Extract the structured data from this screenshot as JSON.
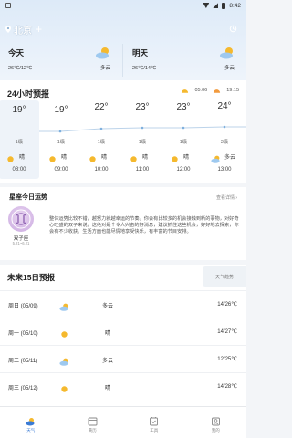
{
  "status_bar": {
    "time": "8:42"
  },
  "header": {
    "city": "北京",
    "add_symbol": "+"
  },
  "today": {
    "label": "今天",
    "temp": "26℃/12℃",
    "condition": "多云"
  },
  "tomorrow": {
    "label": "明天",
    "temp": "26℃/14℃",
    "condition": "多云"
  },
  "hourly": {
    "title": "24小时预报",
    "sunrise": "05:06",
    "sunset": "19:15",
    "items": [
      {
        "temp": "19°",
        "wind": "1级",
        "condition": "晴",
        "time": "08:00",
        "icon": "sun-icon"
      },
      {
        "temp": "19°",
        "wind": "1级",
        "condition": "晴",
        "time": "09:00",
        "icon": "sun-icon"
      },
      {
        "temp": "22°",
        "wind": "1级",
        "condition": "晴",
        "time": "10:00",
        "icon": "sun-icon"
      },
      {
        "temp": "23°",
        "wind": "1级",
        "condition": "晴",
        "time": "11:00",
        "icon": "sun-icon"
      },
      {
        "temp": "23°",
        "wind": "1级",
        "condition": "晴",
        "time": "12:00",
        "icon": "sun-icon"
      },
      {
        "temp": "24°",
        "wind": "3级",
        "condition": "多云",
        "time": "13:00",
        "icon": "partly-cloudy-icon"
      }
    ]
  },
  "horoscope": {
    "title": "星座今日运势",
    "more": "查看详情 ›",
    "sign": "双子座",
    "dates": "5.21~6.21",
    "text": "整体运势比较不错，越努力就越幸运的节奏。你会有比较多的机会接触到新的事物，对好奇心旺盛的双子来说，这绝对是个令人兴奋的好消息，建议抓住这些机会，好好地去探索，你会有不少收获。生活方面也能尽情地享受快乐，有丰富的节目安排。"
  },
  "forecast": {
    "title": "未来15日预报",
    "trend_button": "天气趋势",
    "days": [
      {
        "day": "周日 (05/09)",
        "condition": "多云",
        "temp": "14/26℃",
        "icon": "partly-cloudy-icon"
      },
      {
        "day": "周一 (05/10)",
        "condition": "晴",
        "temp": "14/27℃",
        "icon": "sun-icon"
      },
      {
        "day": "周二 (05/11)",
        "condition": "多云",
        "temp": "12/25℃",
        "icon": "partly-cloudy-icon"
      },
      {
        "day": "周三 (05/12)",
        "condition": "晴",
        "temp": "14/28℃",
        "icon": "sun-icon"
      }
    ]
  },
  "nav": {
    "items": [
      {
        "label": "天气",
        "icon": "weather-icon"
      },
      {
        "label": "黄历",
        "icon": "almanac-icon"
      },
      {
        "label": "工具",
        "icon": "tools-icon"
      },
      {
        "label": "我的",
        "icon": "profile-icon"
      }
    ]
  },
  "colors": {
    "accent": "#3a7bd5",
    "sun": "#f5b92e",
    "cloud": "#9ec9ef"
  }
}
